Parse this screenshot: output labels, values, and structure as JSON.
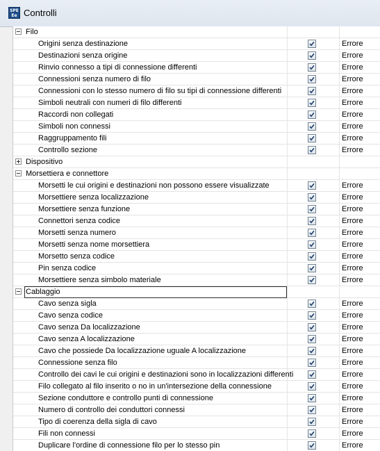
{
  "window": {
    "title": "Controlli",
    "icon_text": "SPE Ee"
  },
  "rows": [
    {
      "type": "group",
      "label": "Filo",
      "expanded": true
    },
    {
      "type": "item",
      "label": "Origini senza destinazione",
      "checked": true,
      "severity": "Errore"
    },
    {
      "type": "item",
      "label": "Destinazioni senza origine",
      "checked": true,
      "severity": "Errore"
    },
    {
      "type": "item",
      "label": "Rinvio connesso a tipi di connessione differenti",
      "checked": true,
      "severity": "Errore"
    },
    {
      "type": "item",
      "label": "Connessioni senza numero di filo",
      "checked": true,
      "severity": "Errore"
    },
    {
      "type": "item",
      "label": "Connessioni con lo stesso numero di filo su tipi di connessione differenti",
      "checked": true,
      "severity": "Errore"
    },
    {
      "type": "item",
      "label": "Simboli neutrali con numeri di filo differenti",
      "checked": true,
      "severity": "Errore"
    },
    {
      "type": "item",
      "label": "Raccordi non collegati",
      "checked": true,
      "severity": "Errore"
    },
    {
      "type": "item",
      "label": "Simboli non connessi",
      "checked": true,
      "severity": "Errore"
    },
    {
      "type": "item",
      "label": "Raggruppamento fili",
      "checked": true,
      "severity": "Errore"
    },
    {
      "type": "item",
      "label": "Controllo sezione",
      "checked": true,
      "severity": "Errore"
    },
    {
      "type": "group",
      "label": "Dispositivo",
      "expanded": false
    },
    {
      "type": "group",
      "label": "Morsettiera e connettore",
      "expanded": true
    },
    {
      "type": "item",
      "label": "Morsetti le cui origini e destinazioni non possono essere visualizzate",
      "checked": true,
      "severity": "Errore"
    },
    {
      "type": "item",
      "label": "Morsettiere senza localizzazione",
      "checked": true,
      "severity": "Errore"
    },
    {
      "type": "item",
      "label": "Morsettiere senza funzione",
      "checked": true,
      "severity": "Errore"
    },
    {
      "type": "item",
      "label": "Connettori senza codice",
      "checked": true,
      "severity": "Errore"
    },
    {
      "type": "item",
      "label": "Morsetti senza numero",
      "checked": true,
      "severity": "Errore"
    },
    {
      "type": "item",
      "label": "Morsetti senza nome morsettiera",
      "checked": true,
      "severity": "Errore"
    },
    {
      "type": "item",
      "label": "Morsetto senza codice",
      "checked": true,
      "severity": "Errore"
    },
    {
      "type": "item",
      "label": "Pin senza codice",
      "checked": true,
      "severity": "Errore"
    },
    {
      "type": "item",
      "label": "Morsettiere senza simbolo materiale",
      "checked": true,
      "severity": "Errore"
    },
    {
      "type": "group",
      "label": "Cablaggio",
      "expanded": true,
      "selected": true
    },
    {
      "type": "item",
      "label": "Cavo senza sigla",
      "checked": true,
      "severity": "Errore"
    },
    {
      "type": "item",
      "label": "Cavo senza codice",
      "checked": true,
      "severity": "Errore"
    },
    {
      "type": "item",
      "label": "Cavo senza Da localizzazione",
      "checked": true,
      "severity": "Errore"
    },
    {
      "type": "item",
      "label": "Cavo senza A localizzazione",
      "checked": true,
      "severity": "Errore"
    },
    {
      "type": "item",
      "label": "Cavo che possiede Da localizzazione uguale A localizzazione",
      "checked": true,
      "severity": "Errore"
    },
    {
      "type": "item",
      "label": "Connessione senza filo",
      "checked": true,
      "severity": "Errore"
    },
    {
      "type": "item",
      "label": "Controllo dei cavi le cui origini e destinazioni sono in localizzazioni differenti",
      "checked": true,
      "severity": "Errore"
    },
    {
      "type": "item",
      "label": "Filo collegato al filo inserito o no in un'intersezione della connessione",
      "checked": true,
      "severity": "Errore"
    },
    {
      "type": "item",
      "label": "Sezione conduttore e controllo punti di connessione",
      "checked": true,
      "severity": "Errore"
    },
    {
      "type": "item",
      "label": "Numero di controllo dei conduttori connessi",
      "checked": true,
      "severity": "Errore"
    },
    {
      "type": "item",
      "label": "Tipo di coerenza della sigla di cavo",
      "checked": true,
      "severity": "Errore"
    },
    {
      "type": "item",
      "label": "Fili non connessi",
      "checked": true,
      "severity": "Errore"
    },
    {
      "type": "item",
      "label": "Duplicare l'ordine di connessione filo per lo stesso pin",
      "checked": true,
      "severity": "Errore"
    }
  ],
  "colors": {
    "check": "#1f3f6e",
    "selection_border": "#2b2b2b"
  }
}
